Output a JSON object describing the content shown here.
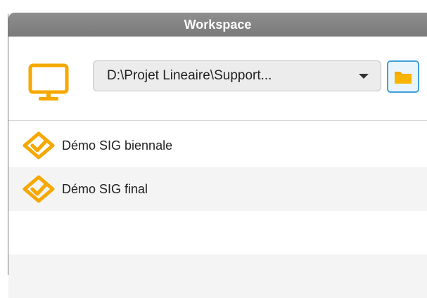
{
  "window": {
    "title": "Workspace"
  },
  "workspace": {
    "icon": "monitor-icon",
    "path_value": "D:\\Projet Lineaire\\Support...",
    "dropdown_icon": "chevron-down-icon",
    "browse_icon": "folder-icon"
  },
  "projects": [
    {
      "label": "Démo SIG biennale",
      "icon": "project-icon"
    },
    {
      "label": "Démo SIG final",
      "icon": "project-icon"
    }
  ],
  "colors": {
    "accent_orange": "#f5a800",
    "title_bar": "#858585",
    "browse_border": "#3fa0d8"
  }
}
